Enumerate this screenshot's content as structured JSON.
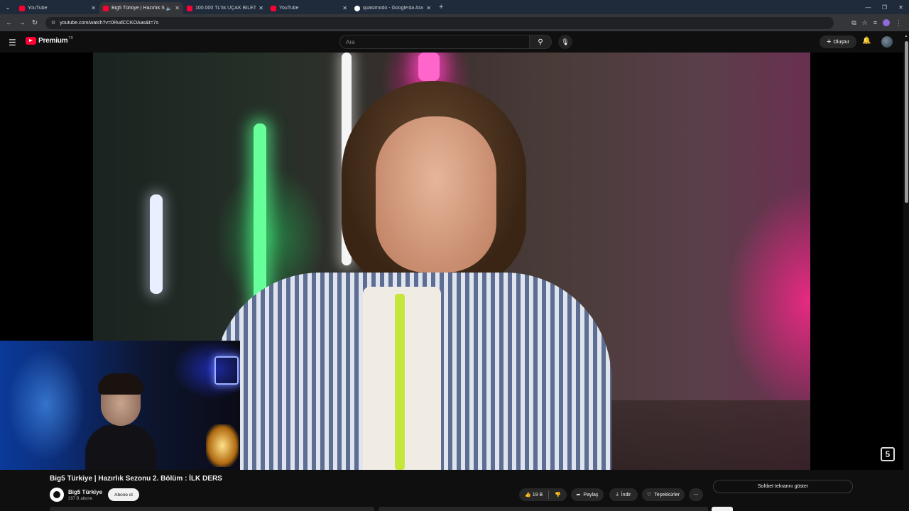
{
  "browser": {
    "tabs": [
      {
        "title": "YouTube",
        "favicon": "youtube-favicon",
        "active": false
      },
      {
        "title": "Big5 Türkiye | Hazırlık Sezonu",
        "favicon": "youtube-favicon",
        "active": true
      },
      {
        "title": "100.000 TL'lik UÇAK BİLETİ ile...",
        "favicon": "youtube-favicon",
        "active": false
      },
      {
        "title": "YouTube",
        "favicon": "youtube-favicon",
        "active": false
      },
      {
        "title": "quasimodo - Google'da Ara",
        "favicon": "google-favicon",
        "active": false
      }
    ],
    "url": "youtube.com/watch?v=0RudCCKOAas&t=7s"
  },
  "youtube": {
    "logo_text": "Premium",
    "logo_region": "TR",
    "search_placeholder": "Ara",
    "create_label": "Oluştur"
  },
  "video": {
    "title": "Big5 Türkiye | Hazırlık Sezonu 2. Bölüm : İLK DERS",
    "channel_bug": "5"
  },
  "channel": {
    "name": "Big5 Türkiye",
    "subscribers": "297 B abone",
    "subscribe_label": "Abone ol"
  },
  "actions": {
    "like_count": "19 B",
    "share_label": "Paylaş",
    "download_label": "İndir",
    "thanks_label": "Teşekkürler",
    "chat_label": "Sohbet tekrarını göster"
  },
  "colors": {
    "brand_red": "#ff0033",
    "background": "#0f0f0f",
    "pill": "#272727"
  }
}
